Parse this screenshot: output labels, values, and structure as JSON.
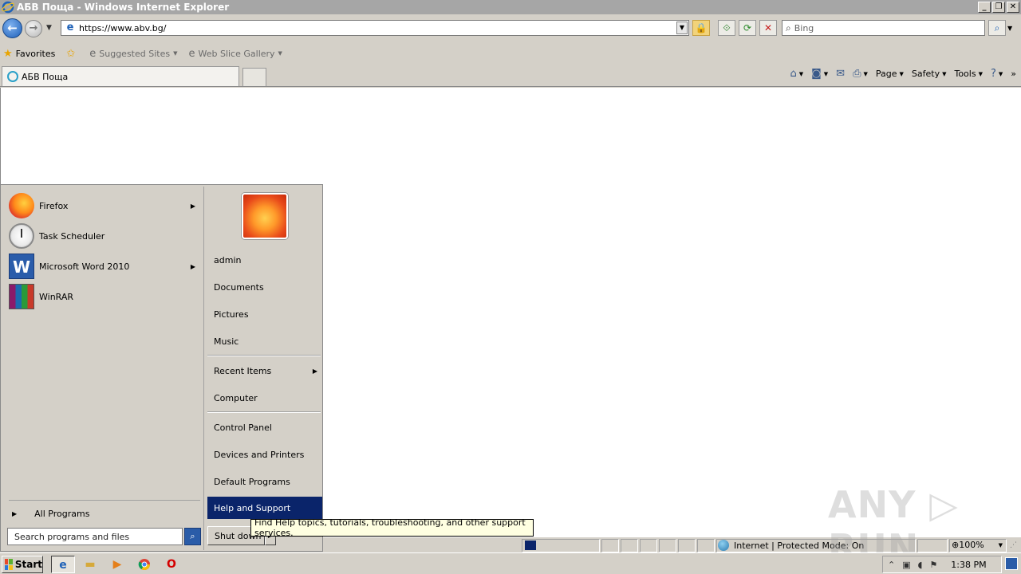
{
  "window": {
    "title": "АБВ Поща - Windows Internet Explorer",
    "minimize": "_",
    "maximize": "❐",
    "close": "✕"
  },
  "address_bar": {
    "url": "https://www.abv.bg/",
    "search_placeholder": "Bing"
  },
  "favorites_bar": {
    "favorites_label": "Favorites",
    "items": [
      {
        "label": "Suggested Sites"
      },
      {
        "label": "Web Slice Gallery"
      }
    ]
  },
  "tabs": [
    {
      "label": "АБВ Поща"
    }
  ],
  "command_bar": {
    "page": "Page",
    "safety": "Safety",
    "tools": "Tools"
  },
  "status_bar": {
    "zone": "Internet | Protected Mode: On",
    "zoom": "100%"
  },
  "start_menu": {
    "programs": [
      {
        "label": "Firefox",
        "has_submenu": true
      },
      {
        "label": "Task Scheduler",
        "has_submenu": false
      },
      {
        "label": "Microsoft Word 2010",
        "has_submenu": true
      },
      {
        "label": "WinRAR",
        "has_submenu": false
      }
    ],
    "all_programs": "All Programs",
    "search_placeholder": "Search programs and files",
    "right_items": [
      {
        "label": "admin"
      },
      {
        "label": "Documents"
      },
      {
        "label": "Pictures"
      },
      {
        "label": "Music"
      },
      {
        "label": "Recent Items"
      },
      {
        "label": "Computer"
      },
      {
        "label": "Control Panel"
      },
      {
        "label": "Devices and Printers"
      },
      {
        "label": "Default Programs"
      },
      {
        "label": "Help and Support"
      }
    ],
    "shutdown": "Shut down",
    "tooltip": "Find Help topics, tutorials, troubleshooting, and other support services."
  },
  "taskbar": {
    "start": "Start",
    "clock": "1:38 PM"
  },
  "watermark": "ANY ▷ RUN"
}
